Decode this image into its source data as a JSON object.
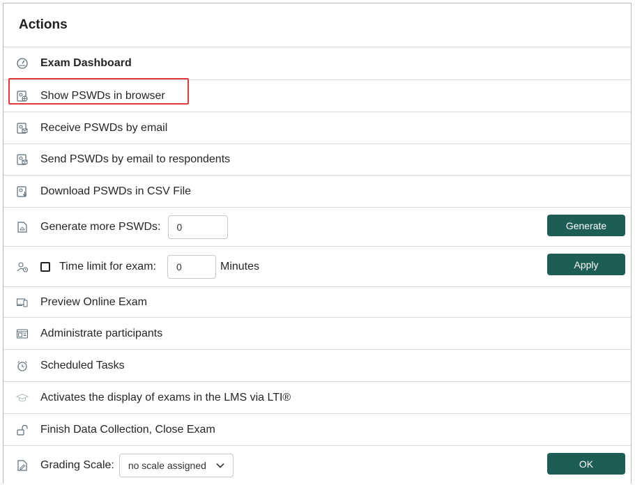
{
  "header": {
    "title": "Actions"
  },
  "rows": {
    "exam_dashboard": "Exam Dashboard",
    "show_pswds": "Show PSWDs in browser",
    "receive_pswds": "Receive PSWDs by email",
    "send_pswds": "Send PSWDs by email to respondents",
    "download_pswds": "Download PSWDs in CSV File",
    "generate_label": "Generate more PSWDs:",
    "generate_value": "0",
    "generate_button": "Generate",
    "time_limit_label": "Time limit for exam:",
    "time_limit_value": "0",
    "minutes_label": "Minutes",
    "apply_button": "Apply",
    "preview_exam": "Preview Online Exam",
    "administrate": "Administrate participants",
    "scheduled_tasks": "Scheduled Tasks",
    "lti": "Activates the display of exams in the LMS via LTI®",
    "finish": "Finish Data Collection, Close Exam",
    "grading_label": "Grading Scale:",
    "grading_value": "no scale assigned",
    "ok_button": "OK"
  },
  "colors": {
    "accent_button": "#1e5c56",
    "highlight_border": "#e0393b",
    "icon_color": "#5a6b73"
  }
}
